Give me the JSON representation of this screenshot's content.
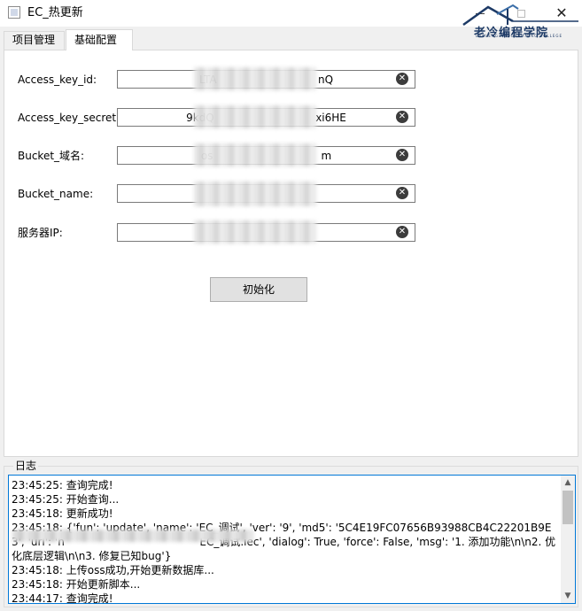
{
  "window": {
    "title": "EC_热更新"
  },
  "logo": {
    "text": "老冷编程学院",
    "subtext": "LAOLENG PROGRAMMING COLLEGE"
  },
  "tabs": [
    {
      "label": "项目管理",
      "active": false
    },
    {
      "label": "基础配置",
      "active": true
    }
  ],
  "form": {
    "fields": [
      {
        "label": "Access_key_id:",
        "value": "LTA                              nQ"
      },
      {
        "label": "Access_key_secret:",
        "value": "9kdQ                              xi6HE"
      },
      {
        "label": "Bucket_域名:",
        "value": "os                                m"
      },
      {
        "label": "Bucket_name:",
        "value": ""
      },
      {
        "label": "服务器IP:",
        "value": ""
      }
    ],
    "init_button": "初始化"
  },
  "log": {
    "title": "日志",
    "lines": [
      "23:45:25: 查询完成!",
      "23:45:25: 开始查询...",
      "23:45:18: 更新成功!",
      "23:45:18: {'fun': 'update', 'name': 'EC_调试', 'ver': '9', 'md5': '5C4E19FC07656B93988CB4C22201B9E3', 'url': 'h                                        EC_调试.iec', 'dialog': True, 'force': False, 'msg': '1. 添加功能\\n\\n2. 优化底层逻辑\\n\\n3. 修复已知bug'}",
      "23:45:18: 上传oss成功,开始更新数据库...",
      "23:45:18: 开始更新脚本...",
      "23:44:17: 查询完成!"
    ]
  },
  "colors": {
    "focus_border": "#0078d7",
    "window_bg": "#f0f0f0"
  }
}
